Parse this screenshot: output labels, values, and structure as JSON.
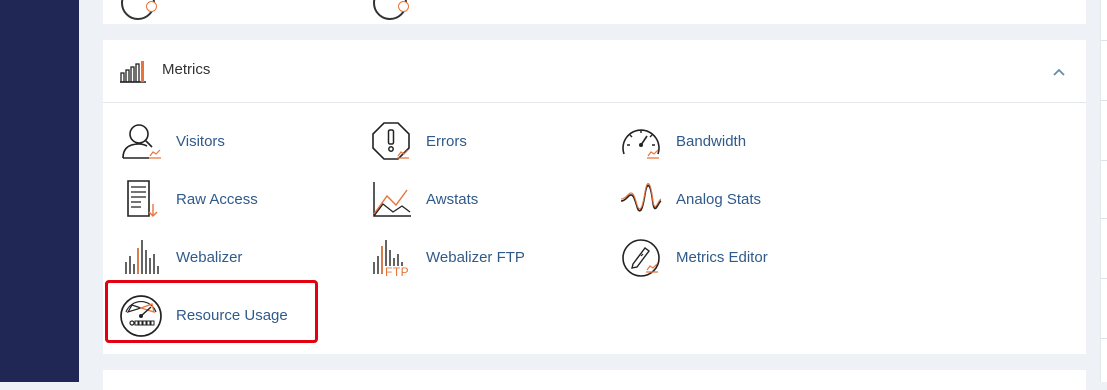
{
  "colors": {
    "sidebar": "#212754",
    "link": "#2f5a8a",
    "accent": "#e8743b",
    "highlight": "#e3000f"
  },
  "metrics": {
    "title": "Metrics",
    "icon": "metrics-bar-chart-icon",
    "items": [
      {
        "label": "Visitors",
        "icon": "visitors-icon"
      },
      {
        "label": "Errors",
        "icon": "errors-icon"
      },
      {
        "label": "Bandwidth",
        "icon": "bandwidth-gauge-icon"
      },
      {
        "label": "Raw Access",
        "icon": "raw-access-document-icon"
      },
      {
        "label": "Awstats",
        "icon": "awstats-line-chart-icon"
      },
      {
        "label": "Analog Stats",
        "icon": "analog-stats-wave-icon"
      },
      {
        "label": "Webalizer",
        "icon": "webalizer-icon"
      },
      {
        "label": "Webalizer FTP",
        "icon": "webalizer-ftp-icon",
        "icon_text": "FTP"
      },
      {
        "label": "Metrics Editor",
        "icon": "metrics-editor-icon"
      },
      {
        "label": "Resource Usage",
        "icon": "resource-usage-gauge-icon",
        "highlighted": true
      }
    ]
  }
}
